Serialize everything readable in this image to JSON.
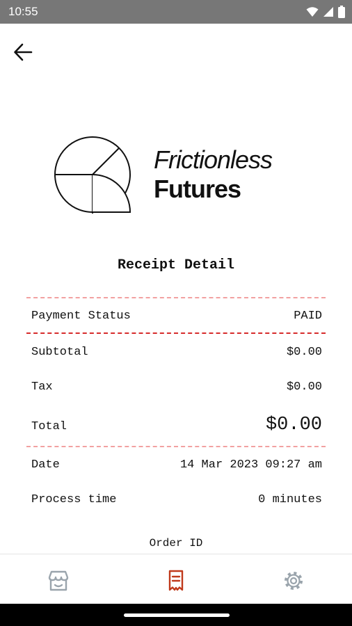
{
  "status_bar": {
    "time": "10:55"
  },
  "brand": {
    "line1": "Frictionless",
    "line2": "Futures"
  },
  "receipt": {
    "title": "Receipt Detail",
    "payment_status_label": "Payment Status",
    "payment_status_value": "PAID",
    "subtotal_label": "Subtotal",
    "subtotal_value": "$0.00",
    "tax_label": "Tax",
    "tax_value": "$0.00",
    "total_label": "Total",
    "total_value": "$0.00",
    "date_label": "Date",
    "date_value": "14 Mar 2023 09:27 am",
    "process_time_label": "Process time",
    "process_time_value": "0 minutes",
    "order_id_label": "Order ID"
  },
  "nav": {
    "items": [
      {
        "icon": "store-icon"
      },
      {
        "icon": "receipt-icon",
        "active": true
      },
      {
        "icon": "settings-gear-icon"
      }
    ],
    "active_color": "#c0391b",
    "inactive_color": "#9aa4ac"
  },
  "colors": {
    "divider_light": "#f2a1a1",
    "divider_strong": "#d62b2b"
  }
}
